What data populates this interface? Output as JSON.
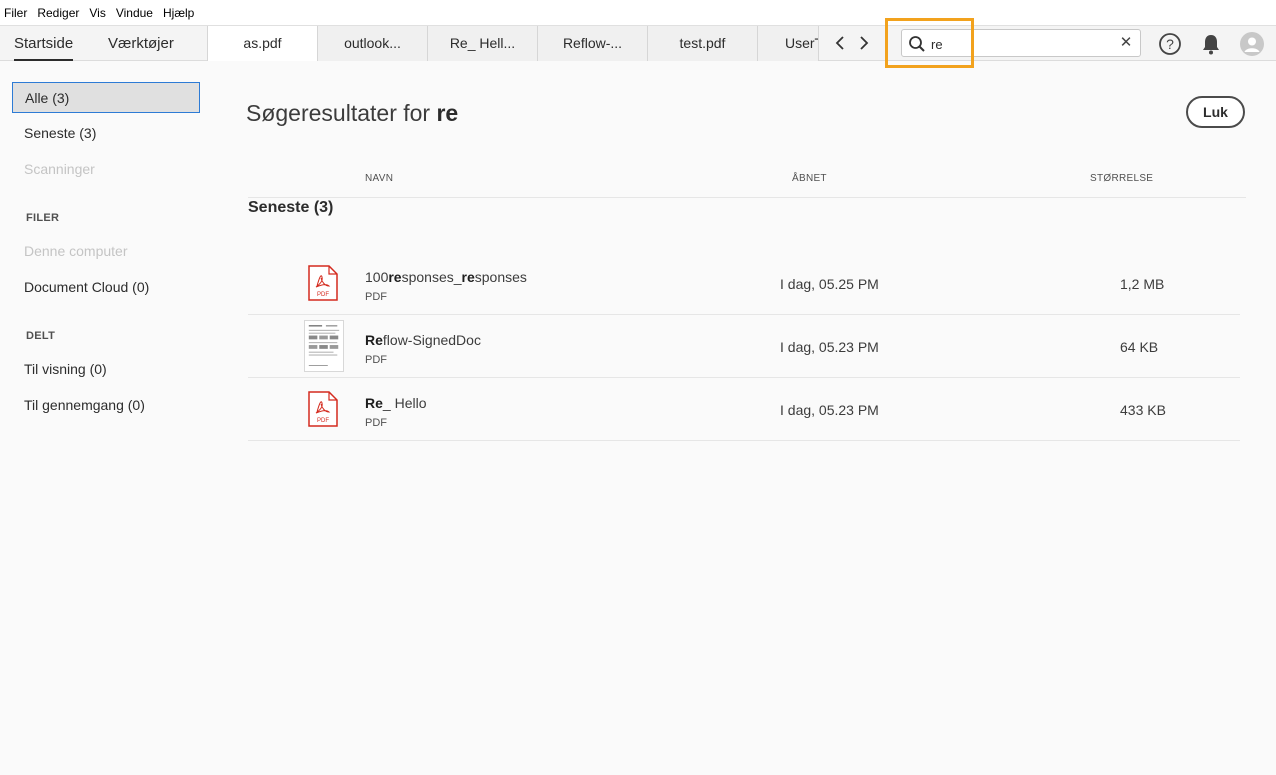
{
  "menu": [
    "Filer",
    "Rediger",
    "Vis",
    "Vindue",
    "Hjælp"
  ],
  "nav": {
    "home": "Startside",
    "tools": "Værktøjer"
  },
  "tabs": [
    "as.pdf",
    "outlook...",
    "Re_ Hell...",
    "Reflow-...",
    "test.pdf",
    "UserT"
  ],
  "search": {
    "value": "re"
  },
  "sidebar": {
    "items": [
      "Alle (3)",
      "Seneste (3)",
      "Scanninger"
    ],
    "files_heading": "FILER",
    "files": [
      "Denne computer",
      "Document Cloud (0)"
    ],
    "shared_heading": "DELT",
    "shared": [
      "Til visning (0)",
      "Til gennemgang (0)"
    ]
  },
  "main": {
    "title_prefix": "Søgeresultater for",
    "title_query": "re",
    "close_label": "Luk",
    "columns": {
      "name": "NAVN",
      "opened": "ÅBNET",
      "size": "STØRRELSE"
    },
    "group_title": "Seneste (3)",
    "rows": [
      {
        "name_parts": [
          "100",
          "re",
          "sponses_",
          "re",
          "sponses"
        ],
        "type": "PDF",
        "opened": "I dag, 05.25 PM",
        "size": "1,2 MB"
      },
      {
        "name_parts": [
          "Re",
          "flow-SignedDoc"
        ],
        "type": "PDF",
        "opened": "I dag, 05.23 PM",
        "size": "64 KB"
      },
      {
        "name_parts": [
          "Re",
          "_ Hello"
        ],
        "type": "PDF",
        "opened": "I dag, 05.23 PM",
        "size": "433 KB"
      }
    ]
  },
  "colors": {
    "accent_highlight": "#f2a21d",
    "pdf_red": "#d42a1e",
    "selected_border": "#2d7bd5"
  },
  "icons": [
    "search-icon",
    "clear-icon",
    "help-icon",
    "bell-icon",
    "avatar-icon",
    "pdf-file-icon",
    "chevron-left-icon",
    "chevron-right-icon"
  ]
}
